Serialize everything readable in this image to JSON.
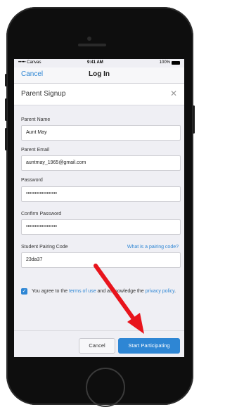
{
  "status_bar": {
    "carrier": "••••• Canvas",
    "time": "9:41 AM",
    "battery": "100%"
  },
  "nav": {
    "cancel_label": "Cancel",
    "title": "Log In"
  },
  "modal": {
    "title": "Parent Signup",
    "close_icon": "close-icon"
  },
  "form": {
    "parent_name_label": "Parent Name",
    "parent_name_value": "Aunt May",
    "parent_email_label": "Parent Email",
    "parent_email_value": "auntmay_1965@gmail.com",
    "password_label": "Password",
    "password_value": "••••••••••••••••••",
    "confirm_password_label": "Confirm Password",
    "confirm_password_value": "••••••••••••••••••",
    "pairing_code_label": "Student Pairing Code",
    "pairing_code_link": "What is a pairing code?",
    "pairing_code_value": "23da37"
  },
  "agreement": {
    "text_before": "You agree to the ",
    "terms_link": "terms of use",
    "text_middle": " and acknowledge the ",
    "privacy_link": "privacy policy",
    "text_after": ".",
    "checked": true
  },
  "footer": {
    "cancel_label": "Cancel",
    "start_label": "Start Participating"
  },
  "colors": {
    "accent": "#2e86d4",
    "annotation_arrow": "#e8141c"
  }
}
